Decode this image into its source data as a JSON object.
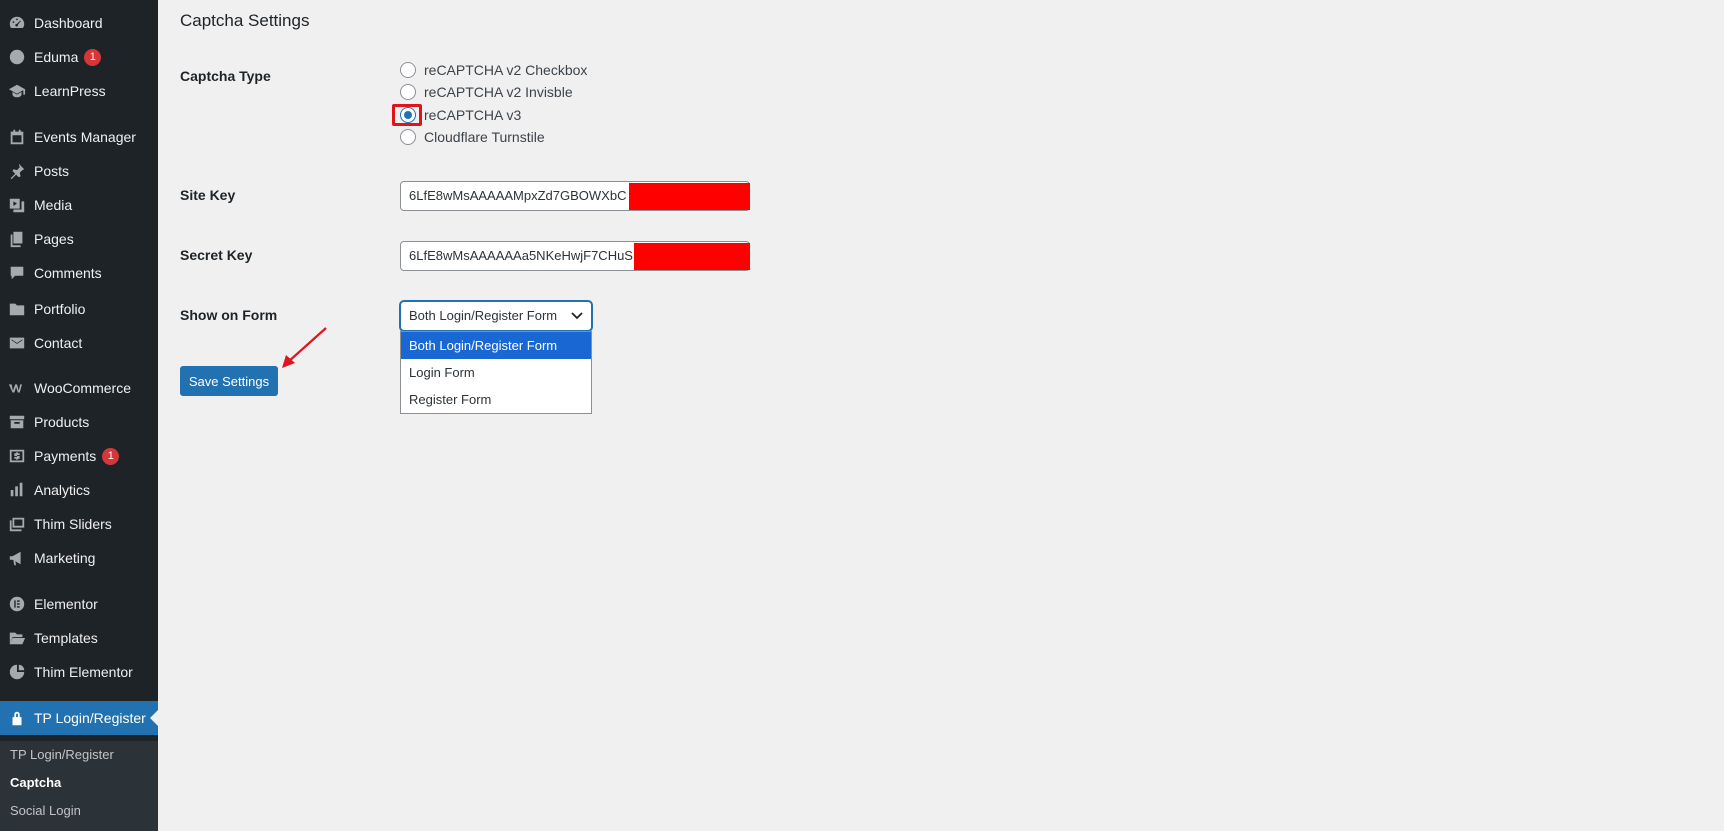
{
  "sidebar": {
    "items": [
      {
        "label": "Dashboard",
        "icon": "dashboard-icon"
      },
      {
        "label": "Eduma",
        "icon": "eduma-icon",
        "badge": "1"
      },
      {
        "label": "LearnPress",
        "icon": "learnpress-icon"
      },
      {
        "label": "Events Manager",
        "icon": "calendar-icon"
      },
      {
        "label": "Posts",
        "icon": "pin-icon"
      },
      {
        "label": "Media",
        "icon": "media-icon"
      },
      {
        "label": "Pages",
        "icon": "pages-icon"
      },
      {
        "label": "Comments",
        "icon": "comment-icon"
      },
      {
        "label": "Portfolio",
        "icon": "folder-icon"
      },
      {
        "label": "Contact",
        "icon": "mail-icon"
      },
      {
        "label": "WooCommerce",
        "icon": "woocommerce-icon"
      },
      {
        "label": "Products",
        "icon": "archive-icon"
      },
      {
        "label": "Payments",
        "icon": "payments-icon",
        "badge": "1"
      },
      {
        "label": "Analytics",
        "icon": "bar-chart-icon"
      },
      {
        "label": "Thim Sliders",
        "icon": "slides-icon"
      },
      {
        "label": "Marketing",
        "icon": "megaphone-icon"
      },
      {
        "label": "Elementor",
        "icon": "elementor-icon"
      },
      {
        "label": "Templates",
        "icon": "folder-open-icon"
      },
      {
        "label": "Thim Elementor",
        "icon": "thim-elementor-icon"
      },
      {
        "label": "TP Login/Register",
        "icon": "lock-icon"
      }
    ],
    "submenu": [
      "TP Login/Register",
      "Captcha",
      "Social Login"
    ]
  },
  "main": {
    "title": "Captcha Settings",
    "captcha_type": {
      "label": "Captcha Type",
      "options": [
        "reCAPTCHA v2 Checkbox",
        "reCAPTCHA v2 Invisble",
        "reCAPTCHA v3",
        "Cloudflare Turnstile"
      ],
      "selected": "reCAPTCHA v3"
    },
    "site_key": {
      "label": "Site Key",
      "value": "6LfE8wMsAAAAAMpxZd7GBOWXbC"
    },
    "secret_key": {
      "label": "Secret Key",
      "value": "6LfE8wMsAAAAAAa5NKeHwjF7CHuS"
    },
    "show_on_form": {
      "label": "Show on Form",
      "value": "Both Login/Register Form",
      "options": [
        "Both Login/Register Form",
        "Login Form",
        "Register Form"
      ]
    },
    "save_label": "Save Settings"
  },
  "colors": {
    "accent": "#2271b1",
    "sidebar_bg": "#1d2327",
    "redaction": "#ff0000",
    "highlight": "#e0151c"
  }
}
